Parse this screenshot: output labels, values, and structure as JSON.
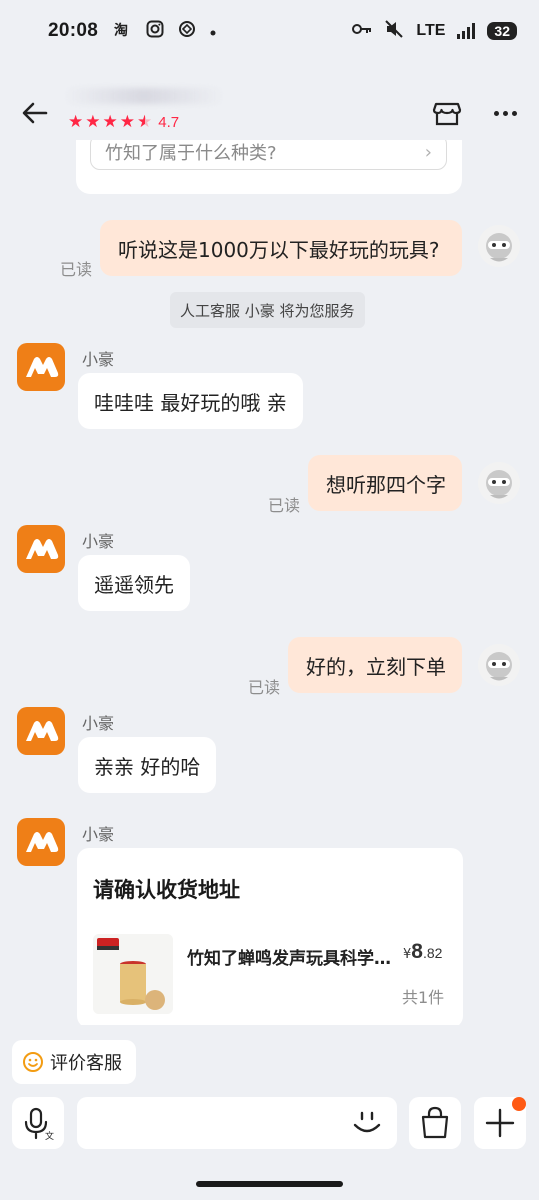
{
  "status_bar": {
    "time": "20:08",
    "left_icons": [
      "taobao-icon",
      "instagram-icon",
      "chatgpt-icon",
      "dot-icon"
    ],
    "network": "LTE",
    "battery": "32"
  },
  "header": {
    "rating_value": "4.7",
    "stars": 4.5
  },
  "chat": {
    "prev_suggestion": "竹知了属于什么种类?",
    "system_note": "人工客服 小豪 将为您服务",
    "read_label": "已读",
    "sender_name": "小豪",
    "messages_out": [
      "听说这是1000万以下最好玩的玩具?",
      "想听那四个字",
      "好的，立刻下单"
    ],
    "messages_in": [
      "哇哇哇 最好玩的哦 亲",
      "遥遥领先",
      "亲亲 好的哈"
    ],
    "order": {
      "title": "请确认收货地址",
      "product_name": "竹知了蝉鸣发声玩具科学实验教具",
      "currency": "¥",
      "price_int": "8",
      "price_dec": ".82",
      "quantity": "共1件"
    }
  },
  "bottom": {
    "rate_label": "评价客服"
  },
  "colors": {
    "accent_red": "#ff2745",
    "bubble_out": "#ffe7d8",
    "shop_orange": "#ef7f17",
    "notify_dot": "#ff5a14"
  }
}
